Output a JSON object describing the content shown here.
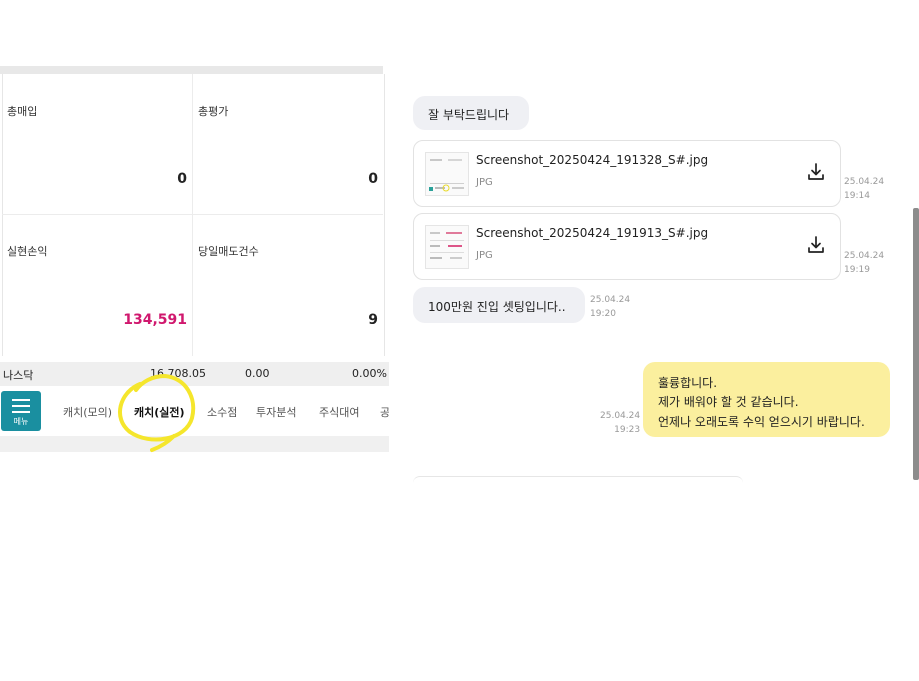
{
  "trading": {
    "cells": {
      "total_buy_label": "총매입",
      "total_buy_value": "0",
      "total_eval_label": "총평가",
      "total_eval_value": "0",
      "realized_pl_label": "실현손익",
      "realized_pl_value": "134,591",
      "today_sell_count_label": "당일매도건수",
      "today_sell_count_value": "9"
    },
    "index_row": {
      "name": "나스닥",
      "price": "16,708.05",
      "change": "0.00",
      "change_pct": "0.00%"
    },
    "menu_label": "메뉴",
    "tabs": [
      "캐치(모의)",
      "캐치(실전)",
      "소수점",
      "투자분석",
      "주식대여",
      "공"
    ],
    "active_tab_index": 1,
    "annotation_color": "#f5e62c"
  },
  "chat": {
    "msg1": "잘 부탁드립니다",
    "files": [
      {
        "name": "Screenshot_20250424_191328_S#.jpg",
        "type": "JPG",
        "date": "25.04.24",
        "time": "19:14"
      },
      {
        "name": "Screenshot_20250424_191913_S#.jpg",
        "type": "JPG",
        "date": "25.04.24",
        "time": "19:19"
      }
    ],
    "msg2": {
      "text": "100만원 진입 셋팅입니다..",
      "date": "25.04.24",
      "time": "19:20"
    },
    "reply": {
      "lines": [
        "훌륭합니다.",
        "제가 배워야 할 것 같습니다.",
        "언제나 오래도록 수익 얻으시기 바랍니다."
      ],
      "date": "25.04.24",
      "time": "19:23"
    }
  }
}
